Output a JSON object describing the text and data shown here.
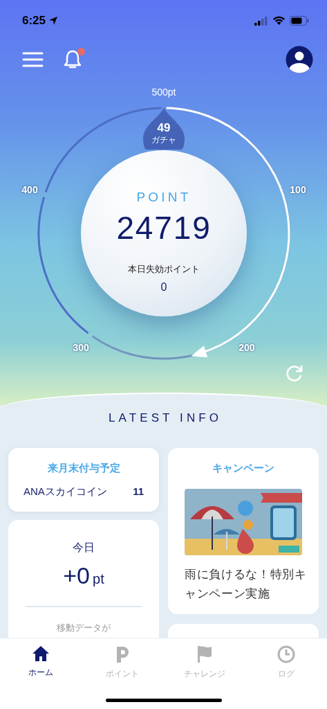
{
  "status_bar": {
    "time": "6:25"
  },
  "header": {
    "notification_badge": true
  },
  "gauge": {
    "max_label": "500pt",
    "scale_labels": [
      "100",
      "200",
      "300",
      "400"
    ],
    "gacha": {
      "count": "49",
      "label": "ガチャ"
    },
    "title": "POINT",
    "points": "24719",
    "expiring_label": "本日失効ポイント",
    "expiring_value": "0"
  },
  "latest_info": {
    "title": "LATEST INFO",
    "next_month": {
      "title": "来月末付与予定",
      "item": "ANAスカイコイン",
      "value": "11"
    },
    "today": {
      "title": "今日",
      "value": "+0",
      "unit": "pt",
      "note": "移動データが"
    },
    "campaign": {
      "title": "キャンペーン",
      "text": "雨に負けるな！特別キャンペーン実施"
    }
  },
  "tab_bar": [
    {
      "kind": "home",
      "label": "ホーム",
      "selected": true
    },
    {
      "kind": "point",
      "label": "ポイント",
      "selected": false
    },
    {
      "kind": "challenge",
      "label": "チャレンジ",
      "selected": false
    },
    {
      "kind": "log",
      "label": "ログ",
      "selected": false
    }
  ]
}
